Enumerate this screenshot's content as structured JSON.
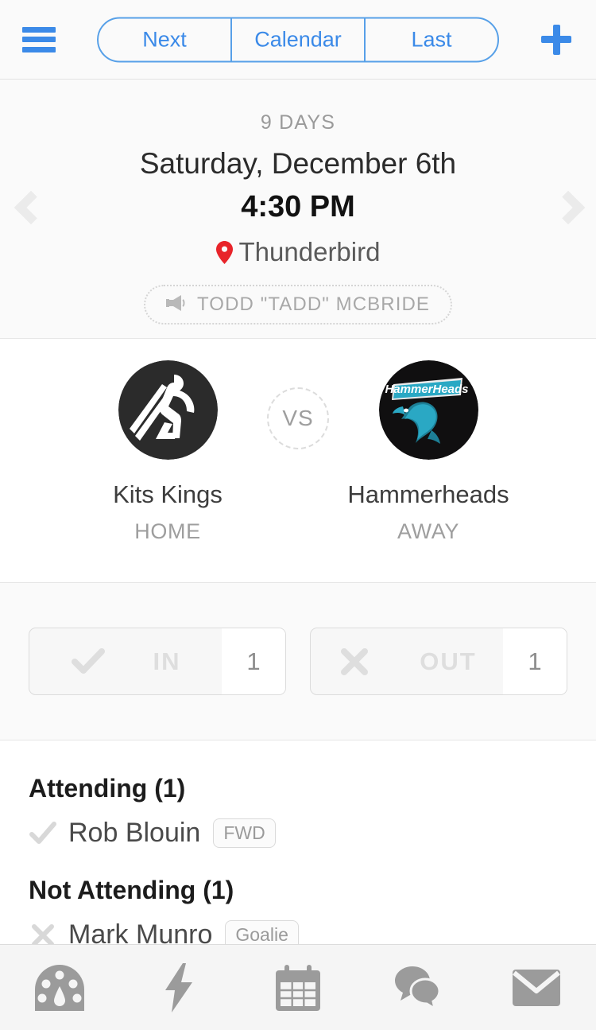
{
  "topbar": {
    "menu_icon": "hamburger-menu-icon",
    "segments": [
      {
        "label": "Next"
      },
      {
        "label": "Calendar"
      },
      {
        "label": "Last"
      }
    ],
    "add_icon": "plus-icon",
    "accent_color": "#3b8ae8"
  },
  "game": {
    "countdown": "9 DAYS",
    "date": "Saturday, December 6th",
    "time": "4:30 PM",
    "venue": "Thunderbird",
    "venue_icon": "map-pin-icon",
    "venue_pin_color": "#e8242a",
    "coach": "TODD \"TADD\" MCBRIDE",
    "coach_icon": "megaphone-icon",
    "prev_icon": "chevron-left-icon",
    "next_icon": "chevron-right-icon"
  },
  "matchup": {
    "vs_label": "VS",
    "home": {
      "name": "Kits Kings",
      "role": "HOME",
      "logo_name": "kits-kings-logo",
      "logo_bg": "#2b2b2b",
      "logo_fg": "#ffffff"
    },
    "away": {
      "name": "Hammerheads",
      "role": "AWAY",
      "logo_name": "hammerheads-logo",
      "logo_bg": "#100f10",
      "logo_fg": "#2aa8c4"
    }
  },
  "rsvp": {
    "in": {
      "label": "IN",
      "count": "1",
      "icon": "check-icon"
    },
    "out": {
      "label": "OUT",
      "count": "1",
      "icon": "x-icon"
    }
  },
  "attendance": {
    "attending_heading": "Attending (1)",
    "attending": [
      {
        "name": "Rob Blouin",
        "position": "FWD",
        "mark": "check-icon"
      }
    ],
    "not_attending_heading": "Not Attending (1)",
    "not_attending": [
      {
        "name": "Mark Munro",
        "position": "Goalie",
        "mark": "x-icon"
      }
    ]
  },
  "tabbar": {
    "items": [
      {
        "icon": "dashboard-gauge-icon"
      },
      {
        "icon": "lightning-bolt-icon"
      },
      {
        "icon": "calendar-icon"
      },
      {
        "icon": "chat-bubbles-icon"
      },
      {
        "icon": "envelope-icon"
      }
    ]
  }
}
